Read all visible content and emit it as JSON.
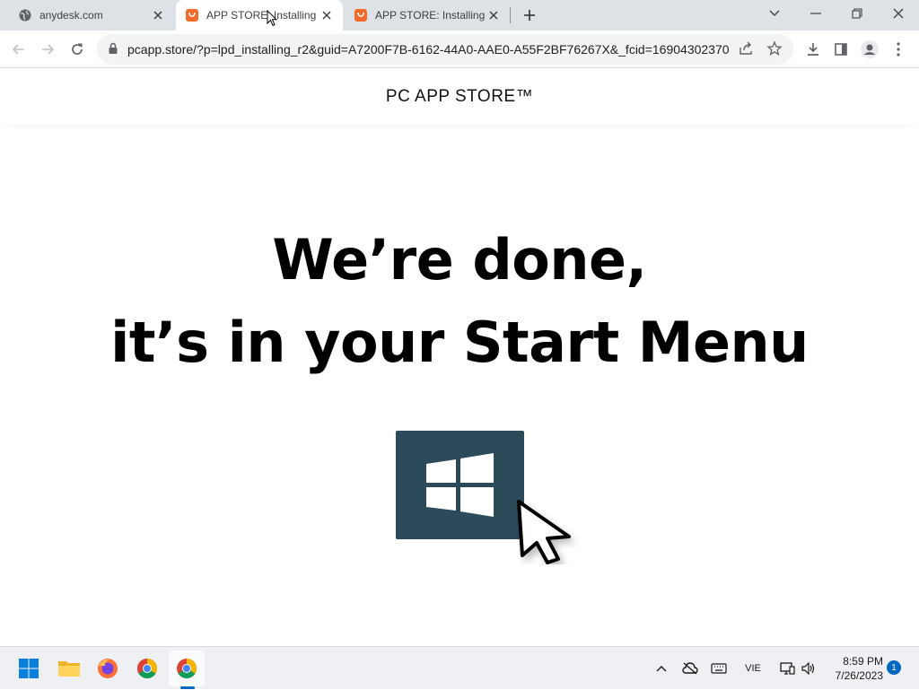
{
  "tabs": [
    {
      "title": "anydesk.com",
      "favicon": "globe-icon"
    },
    {
      "title": "APP STORE: Installing",
      "favicon": "shopping-bag-icon"
    },
    {
      "title": "APP STORE: Installing",
      "favicon": "shopping-bag-icon"
    }
  ],
  "address_bar": {
    "url": "pcapp.store/?p=lpd_installing_r2&guid=A7200F7B-6162-44A0-AAE0-A55F2BF76267X&_fcid=16904302370..."
  },
  "page": {
    "site_title": "PC APP STORE™",
    "headline_line1": "We’re done,",
    "headline_line2": "it’s in your Start Menu"
  },
  "taskbar": {
    "language": "VIE",
    "time": "8:59 PM",
    "date": "7/26/2023",
    "notification_count": "1"
  },
  "colors": {
    "accent_orange": "#f46b2c",
    "windows_tile": "#2c4a5a",
    "taskbar_blue": "#0067c0"
  }
}
